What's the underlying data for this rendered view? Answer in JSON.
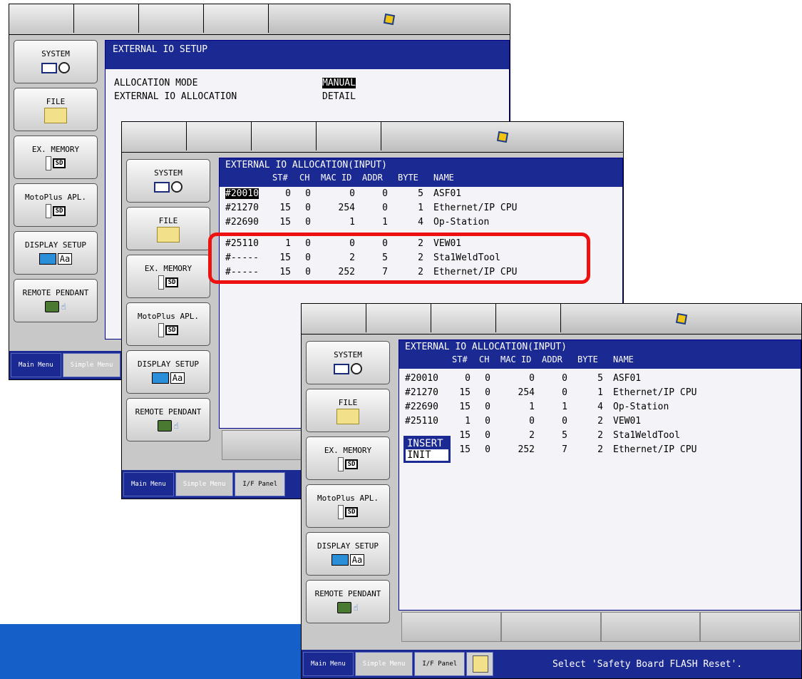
{
  "common": {
    "menu": [
      "SYSTEM",
      "FILE",
      "EX. MEMORY",
      "MotoPlus APL.",
      "DISPLAY SETUP",
      "REMOTE PENDANT"
    ],
    "tab_main": "Main Menu",
    "tab_simple": "Simple Menu",
    "tab_if": "I/F Panel"
  },
  "win1": {
    "title": "EXTERNAL IO SETUP",
    "mode_label": "ALLOCATION MODE",
    "mode_value": "MANUAL",
    "alloc_label": "EXTERNAL IO ALLOCATION",
    "alloc_value": "DETAIL"
  },
  "table": {
    "title": "EXTERNAL IO ALLOCATION(INPUT)",
    "headers": [
      "ST#",
      "CH",
      "MAC ID",
      "ADDR",
      "BYTE",
      "NAME"
    ]
  },
  "win2": {
    "rows": [
      {
        "id": "#20010",
        "st": "0",
        "ch": "0",
        "mac": "0",
        "addr": "0",
        "byte": "5",
        "name": "ASF01"
      },
      {
        "id": "#21270",
        "st": "15",
        "ch": "0",
        "mac": "254",
        "addr": "0",
        "byte": "1",
        "name": "Ethernet/IP CPU"
      },
      {
        "id": "#22690",
        "st": "15",
        "ch": "0",
        "mac": "1",
        "addr": "1",
        "byte": "4",
        "name": "Op-Station"
      },
      {
        "id": "#25110",
        "st": "1",
        "ch": "0",
        "mac": "0",
        "addr": "0",
        "byte": "2",
        "name": "VEW01"
      },
      {
        "id": "#-----",
        "st": "15",
        "ch": "0",
        "mac": "2",
        "addr": "5",
        "byte": "2",
        "name": "Sta1WeldTool"
      },
      {
        "id": "#-----",
        "st": "15",
        "ch": "0",
        "mac": "252",
        "addr": "7",
        "byte": "2",
        "name": "Ethernet/IP CPU"
      }
    ]
  },
  "win3": {
    "rows": [
      {
        "id": "#20010",
        "st": "0",
        "ch": "0",
        "mac": "0",
        "addr": "0",
        "byte": "5",
        "name": "ASF01"
      },
      {
        "id": "#21270",
        "st": "15",
        "ch": "0",
        "mac": "254",
        "addr": "0",
        "byte": "1",
        "name": "Ethernet/IP CPU"
      },
      {
        "id": "#22690",
        "st": "15",
        "ch": "0",
        "mac": "1",
        "addr": "1",
        "byte": "4",
        "name": "Op-Station"
      },
      {
        "id": "#25110",
        "st": "1",
        "ch": "0",
        "mac": "0",
        "addr": "0",
        "byte": "2",
        "name": "VEW01"
      },
      {
        "id": "",
        "st": "15",
        "ch": "0",
        "mac": "2",
        "addr": "5",
        "byte": "2",
        "name": "Sta1WeldTool"
      },
      {
        "id": "",
        "st": "15",
        "ch": "0",
        "mac": "252",
        "addr": "7",
        "byte": "2",
        "name": "Ethernet/IP CPU"
      }
    ],
    "popup": [
      "INSERT",
      "INIT"
    ],
    "status": "Select 'Safety Board FLASH Reset'."
  }
}
